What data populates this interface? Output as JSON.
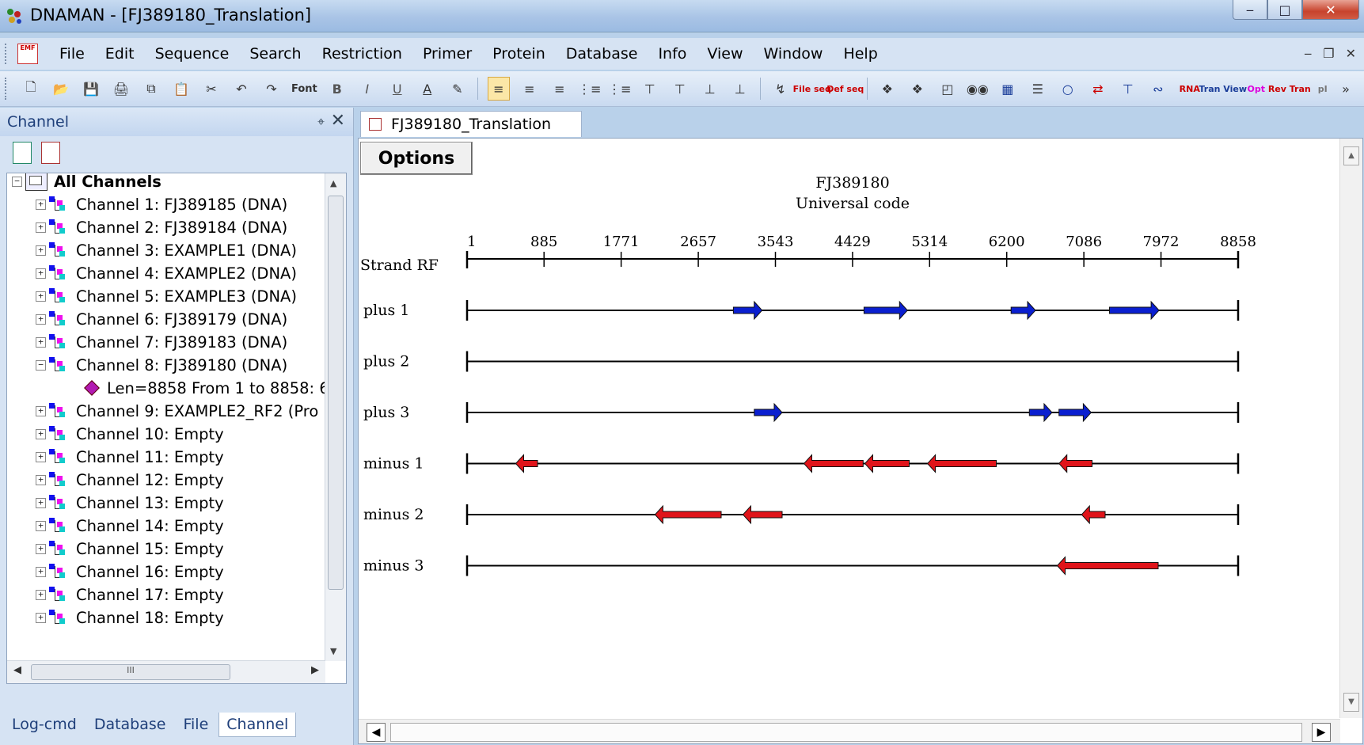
{
  "window": {
    "title": "DNAMAN - [FJ389180_Translation]",
    "minimize": "‒",
    "maximize": "□",
    "close": "✕"
  },
  "menu": [
    {
      "label": "File"
    },
    {
      "label": "Edit"
    },
    {
      "label": "Sequence"
    },
    {
      "label": "Search"
    },
    {
      "label": "Restriction"
    },
    {
      "label": "Primer"
    },
    {
      "label": "Protein"
    },
    {
      "label": "Database"
    },
    {
      "label": "Info"
    },
    {
      "label": "View"
    },
    {
      "label": "Window"
    },
    {
      "label": "Help"
    }
  ],
  "toolbar": {
    "font_label": "Font",
    "bold": "B",
    "italic": "I",
    "underline": "U",
    "file_seq": "File seq",
    "def_seq": "Def seq",
    "rna": "RNA",
    "tran_view": "Tran View",
    "opt": "Opt",
    "rev_tran": "Rev Tran",
    "pi": "pI"
  },
  "channel_panel": {
    "title": "Channel",
    "pin": "⌖",
    "close": "✕",
    "root": "All Channels",
    "channels": [
      {
        "label": "Channel 1: FJ389185 (DNA)",
        "expander": "+"
      },
      {
        "label": "Channel 2: FJ389184 (DNA)",
        "expander": "+"
      },
      {
        "label": "Channel 3: EXAMPLE1 (DNA)",
        "expander": "+"
      },
      {
        "label": "Channel 4: EXAMPLE2 (DNA)",
        "expander": "+"
      },
      {
        "label": "Channel 5: EXAMPLE3 (DNA)",
        "expander": "+"
      },
      {
        "label": "Channel 6: FJ389179 (DNA)",
        "expander": "+"
      },
      {
        "label": "Channel 7: FJ389183 (DNA)",
        "expander": "+"
      },
      {
        "label": "Channel 8: FJ389180 (DNA)",
        "expander": "−",
        "child": "Len=8858 From 1 to 8858: 6"
      },
      {
        "label": "Channel 9: EXAMPLE2_RF2 (Pro",
        "expander": "+"
      },
      {
        "label": "Channel 10: Empty",
        "expander": "+"
      },
      {
        "label": "Channel 11: Empty",
        "expander": "+"
      },
      {
        "label": "Channel 12: Empty",
        "expander": "+"
      },
      {
        "label": "Channel 13: Empty",
        "expander": "+"
      },
      {
        "label": "Channel 14: Empty",
        "expander": "+"
      },
      {
        "label": "Channel 15: Empty",
        "expander": "+"
      },
      {
        "label": "Channel 16: Empty",
        "expander": "+"
      },
      {
        "label": "Channel 17: Empty",
        "expander": "+"
      },
      {
        "label": "Channel 18: Empty",
        "expander": "+"
      }
    ],
    "bottom_tabs": [
      "Log-cmd",
      "Database",
      "File",
      "Channel"
    ],
    "active_tab": "Channel"
  },
  "document": {
    "tab_title": "FJ389180_Translation",
    "options_button": "Options",
    "map_title": "FJ389180",
    "map_subtitle": "Universal code",
    "strand_header": "Strand RF",
    "sequence_length": 8858,
    "ruler_ticks": [
      1,
      885,
      1771,
      2657,
      3543,
      4429,
      5314,
      6200,
      7086,
      7972,
      8858
    ],
    "frames": [
      {
        "label": "plus   1",
        "direction": "forward",
        "color": "#0a1fd0",
        "orfs": [
          [
            3060,
            3390
          ],
          [
            4560,
            5060
          ],
          [
            6250,
            6530
          ],
          [
            7380,
            7950
          ]
        ]
      },
      {
        "label": "plus   2",
        "direction": "forward",
        "color": "#0a1fd0",
        "orfs": []
      },
      {
        "label": "plus   3",
        "direction": "forward",
        "color": "#0a1fd0",
        "orfs": [
          [
            3300,
            3620
          ],
          [
            6460,
            6720
          ],
          [
            6800,
            7170
          ]
        ]
      },
      {
        "label": "minus   1",
        "direction": "reverse",
        "color": "#e0141a",
        "orfs": [
          [
            560,
            810
          ],
          [
            3870,
            4550
          ],
          [
            4570,
            5080
          ],
          [
            5290,
            6080
          ],
          [
            6800,
            7180
          ]
        ]
      },
      {
        "label": "minus   2",
        "direction": "reverse",
        "color": "#e0141a",
        "orfs": [
          [
            2160,
            2920
          ],
          [
            3170,
            3620
          ],
          [
            7060,
            7330
          ]
        ]
      },
      {
        "label": "minus   3",
        "direction": "reverse",
        "color": "#e0141a",
        "orfs": [
          [
            6780,
            7940
          ]
        ]
      }
    ]
  }
}
